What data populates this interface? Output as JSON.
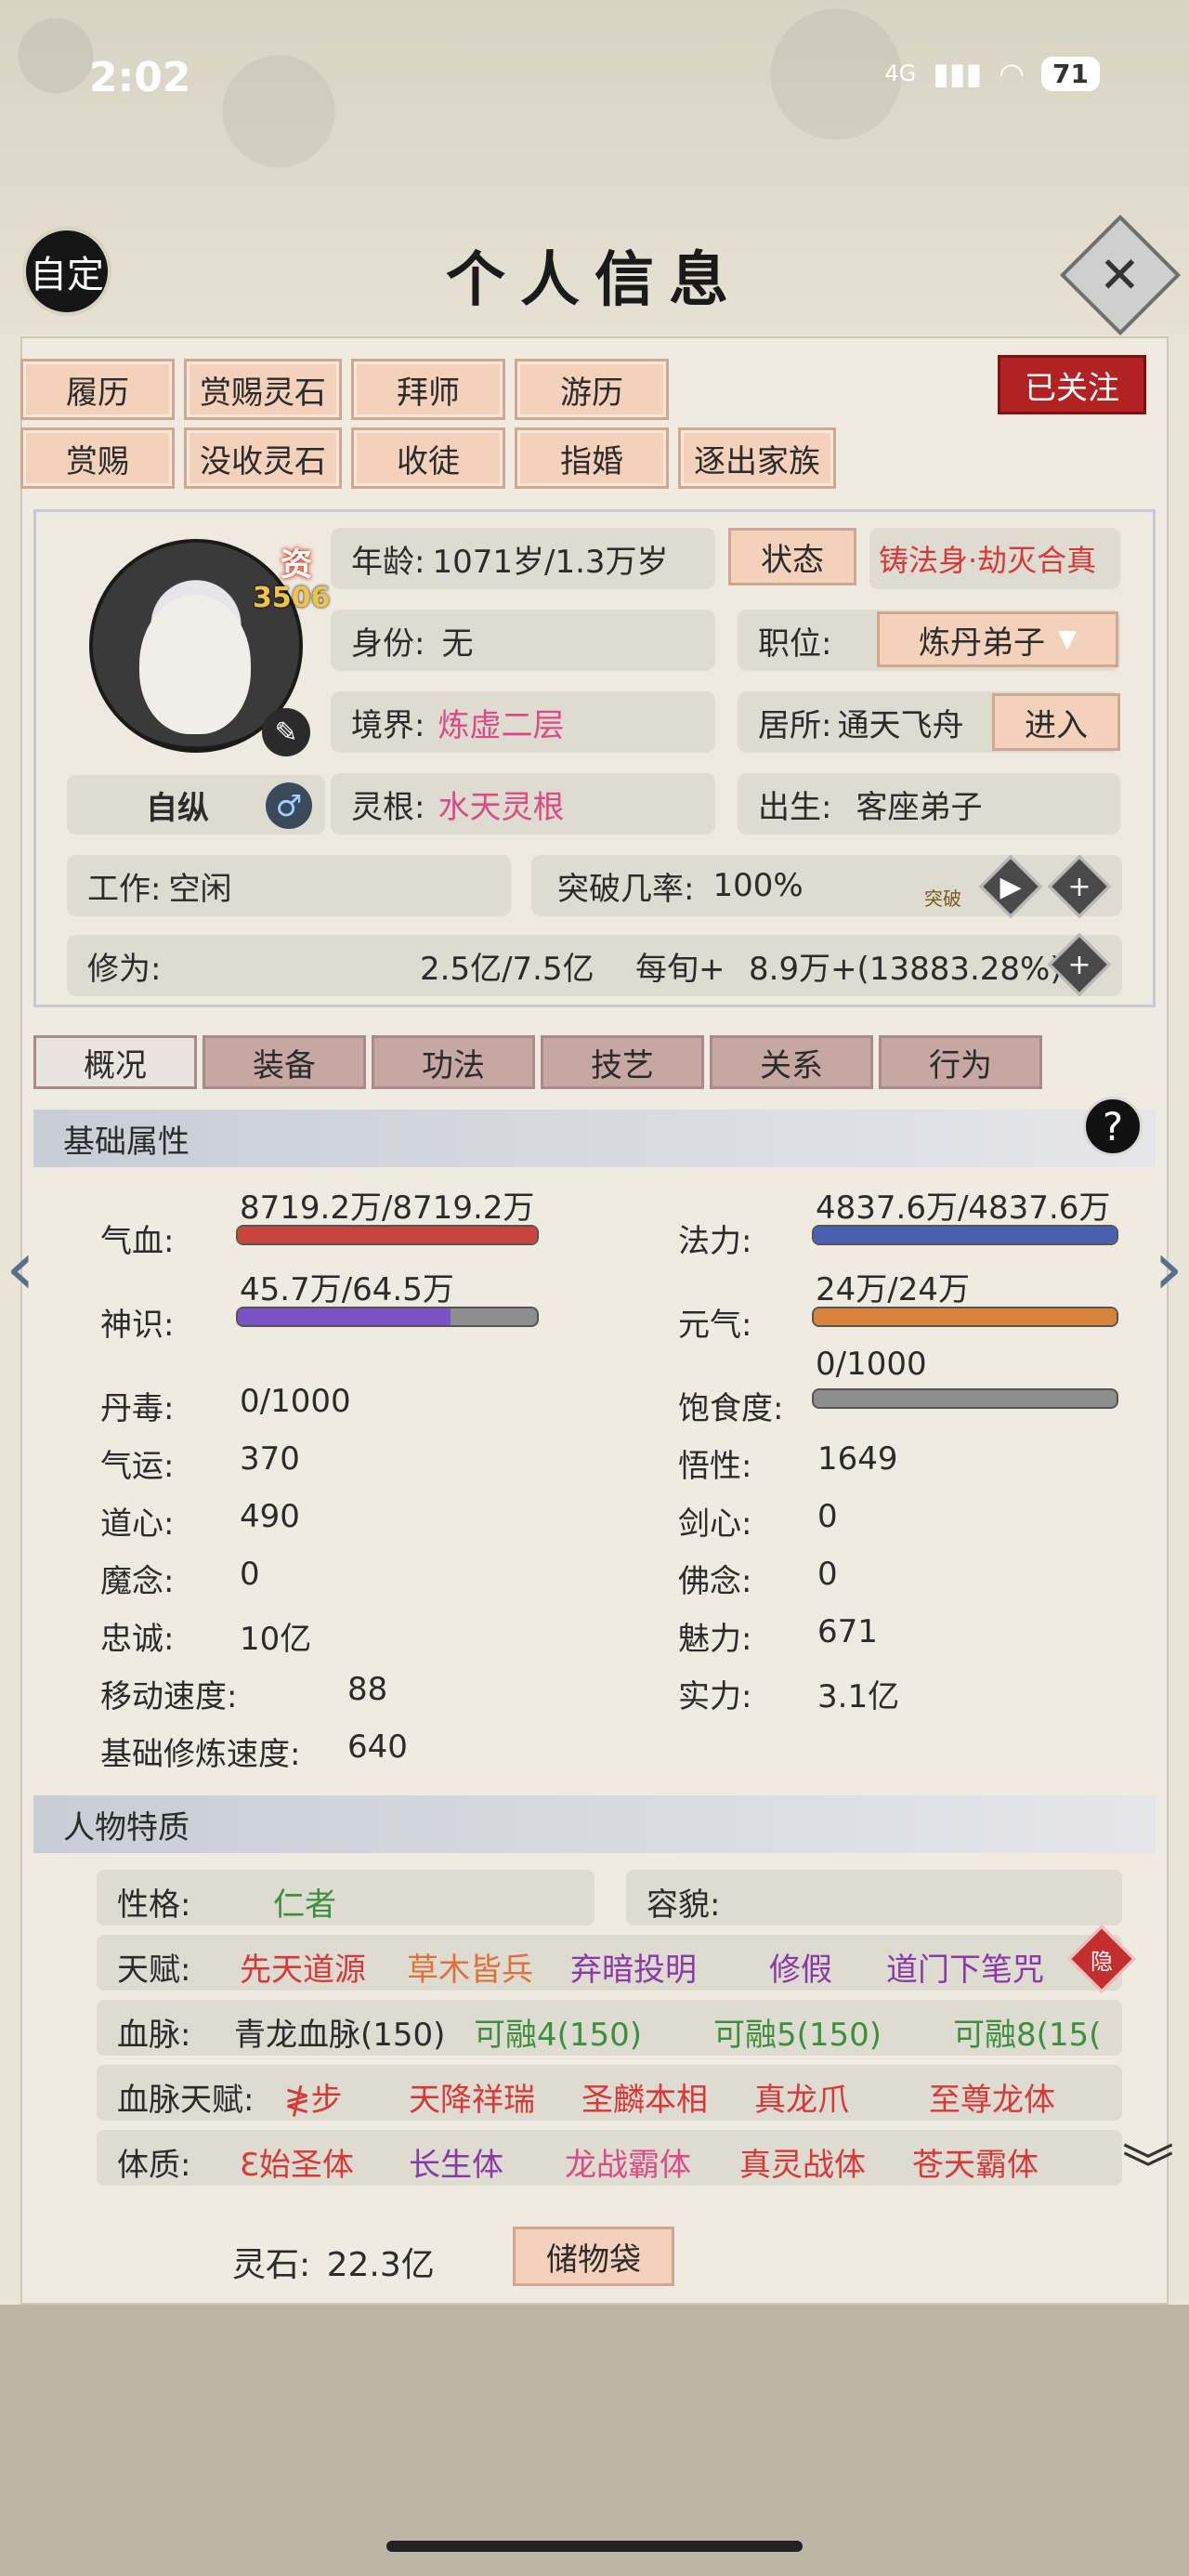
{
  "status_bar": {
    "time": "2:02",
    "network": "4G",
    "battery": "71"
  },
  "header": {
    "custom_label": "自定",
    "title": "个人信息",
    "close_symbol": "✕"
  },
  "actions": {
    "row1": [
      "履历",
      "赏赐灵石",
      "拜师",
      "游历"
    ],
    "row2": [
      "赏赐",
      "没收灵石",
      "收徒",
      "指婚",
      "逐出家族"
    ],
    "follow": "已关注"
  },
  "character": {
    "zi_label": "资",
    "zi_value": "3506",
    "name": "自纵",
    "gender_symbol": "♂",
    "age_label": "年龄:",
    "age_value": "1071岁/1.3万岁",
    "status_button": "状态",
    "status_text": "铸法身·劫灭合真",
    "identity_label": "身份:",
    "identity_value": "无",
    "position_label": "职位:",
    "position_value": "炼丹弟子",
    "realm_label": "境界:",
    "realm_value": "炼虚二层",
    "residence_label": "居所:",
    "residence_value": "通天飞舟",
    "enter_button": "进入",
    "root_label": "灵根:",
    "root_value": "水天灵根",
    "birth_label": "出生:",
    "birth_value": "客座弟子",
    "work_label": "工作:",
    "work_value": "空闲",
    "breakthrough_label": "突破几率:",
    "breakthrough_value": "100%",
    "breakthrough_icon_label": "突破",
    "cultivation_label": "修为:",
    "cultivation_value": "2.5亿/7.5亿",
    "per_turn_label": "每旬+",
    "per_turn_value": "8.9万+(13883.28%)"
  },
  "tabs": [
    "概况",
    "装备",
    "功法",
    "技艺",
    "关系",
    "行为"
  ],
  "basic_section": {
    "title": "基础属性",
    "qixue_label": "气血:",
    "qixue_value": "8719.2万/8719.2万",
    "qixue_fill": 1.0,
    "fali_label": "法力:",
    "fali_value": "4837.6万/4837.6万",
    "fali_fill": 1.0,
    "shenshi_label": "神识:",
    "shenshi_value": "45.7万/64.5万",
    "shenshi_fill": 0.71,
    "yuanqi_label": "元气:",
    "yuanqi_value": "24万/24万",
    "yuanqi_fill": 1.0,
    "baoshi_label": "饱食度:",
    "baoshi_value": "0/1000",
    "baoshi_fill": 0.0,
    "rows": [
      {
        "l1": "丹毒:",
        "v1": "0/1000",
        "l2": "",
        "v2": ""
      },
      {
        "l1": "气运:",
        "v1": "370",
        "l2": "悟性:",
        "v2": "1649"
      },
      {
        "l1": "道心:",
        "v1": "490",
        "l2": "剑心:",
        "v2": "0"
      },
      {
        "l1": "魔念:",
        "v1": "0",
        "l2": "佛念:",
        "v2": "0"
      },
      {
        "l1": "忠诚:",
        "v1": "10亿",
        "l2": "魅力:",
        "v2": "671"
      },
      {
        "l1": "移动速度:",
        "v1": "88",
        "l2": "实力:",
        "v2": "3.1亿"
      },
      {
        "l1": "基础修炼速度:",
        "v1": "640",
        "l2": "",
        "v2": ""
      }
    ]
  },
  "traits_section": {
    "title": "人物特质",
    "personality_label": "性格:",
    "personality_value": "仁者",
    "looks_label": "容貌:",
    "talent_label": "天赋:",
    "talents": [
      "先天道源",
      "草木皆兵",
      "弃暗投明",
      "修假",
      "道门下笔咒"
    ],
    "hidden_label": "隐",
    "blood_label": "血脉:",
    "blood_items": [
      "青龙血脉(150)",
      "可融4(150)",
      "可融5(150)",
      "可融8(15("
    ],
    "blood_talent_label": "血脉天赋:",
    "blood_talents": [
      "≹步",
      "天降祥瑞",
      "圣麟本相",
      "真龙爪",
      "至尊龙体"
    ],
    "physique_label": "体质:",
    "physiques": [
      "ℇ始圣体",
      "长生体",
      "龙战霸体",
      "真灵战体",
      "苍天霸体"
    ]
  },
  "footer": {
    "stones_label": "灵石:",
    "stones_value": "22.3亿",
    "storage_button": "储物袋"
  },
  "colors": {
    "qixue": "#c8443c",
    "fali": "#4a5fb0",
    "shenshi": "#7a52c4",
    "yuanqi": "#d8833a",
    "red": "#d83838",
    "pink": "#de4a86",
    "green": "#3c8f3c",
    "purple": "#8a3aa8"
  }
}
